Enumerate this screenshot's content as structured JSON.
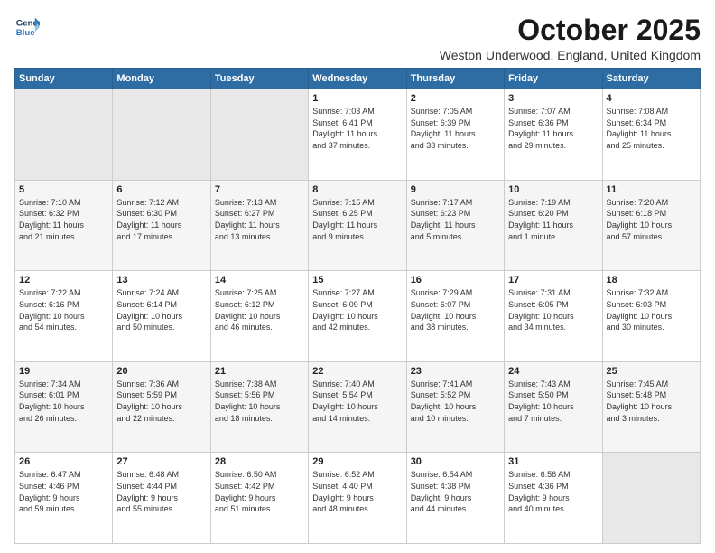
{
  "logo": {
    "line1": "General",
    "line2": "Blue"
  },
  "title": "October 2025",
  "location": "Weston Underwood, England, United Kingdom",
  "days_of_week": [
    "Sunday",
    "Monday",
    "Tuesday",
    "Wednesday",
    "Thursday",
    "Friday",
    "Saturday"
  ],
  "weeks": [
    [
      {
        "day": "",
        "info": ""
      },
      {
        "day": "",
        "info": ""
      },
      {
        "day": "",
        "info": ""
      },
      {
        "day": "1",
        "info": "Sunrise: 7:03 AM\nSunset: 6:41 PM\nDaylight: 11 hours\nand 37 minutes."
      },
      {
        "day": "2",
        "info": "Sunrise: 7:05 AM\nSunset: 6:39 PM\nDaylight: 11 hours\nand 33 minutes."
      },
      {
        "day": "3",
        "info": "Sunrise: 7:07 AM\nSunset: 6:36 PM\nDaylight: 11 hours\nand 29 minutes."
      },
      {
        "day": "4",
        "info": "Sunrise: 7:08 AM\nSunset: 6:34 PM\nDaylight: 11 hours\nand 25 minutes."
      }
    ],
    [
      {
        "day": "5",
        "info": "Sunrise: 7:10 AM\nSunset: 6:32 PM\nDaylight: 11 hours\nand 21 minutes."
      },
      {
        "day": "6",
        "info": "Sunrise: 7:12 AM\nSunset: 6:30 PM\nDaylight: 11 hours\nand 17 minutes."
      },
      {
        "day": "7",
        "info": "Sunrise: 7:13 AM\nSunset: 6:27 PM\nDaylight: 11 hours\nand 13 minutes."
      },
      {
        "day": "8",
        "info": "Sunrise: 7:15 AM\nSunset: 6:25 PM\nDaylight: 11 hours\nand 9 minutes."
      },
      {
        "day": "9",
        "info": "Sunrise: 7:17 AM\nSunset: 6:23 PM\nDaylight: 11 hours\nand 5 minutes."
      },
      {
        "day": "10",
        "info": "Sunrise: 7:19 AM\nSunset: 6:20 PM\nDaylight: 11 hours\nand 1 minute."
      },
      {
        "day": "11",
        "info": "Sunrise: 7:20 AM\nSunset: 6:18 PM\nDaylight: 10 hours\nand 57 minutes."
      }
    ],
    [
      {
        "day": "12",
        "info": "Sunrise: 7:22 AM\nSunset: 6:16 PM\nDaylight: 10 hours\nand 54 minutes."
      },
      {
        "day": "13",
        "info": "Sunrise: 7:24 AM\nSunset: 6:14 PM\nDaylight: 10 hours\nand 50 minutes."
      },
      {
        "day": "14",
        "info": "Sunrise: 7:25 AM\nSunset: 6:12 PM\nDaylight: 10 hours\nand 46 minutes."
      },
      {
        "day": "15",
        "info": "Sunrise: 7:27 AM\nSunset: 6:09 PM\nDaylight: 10 hours\nand 42 minutes."
      },
      {
        "day": "16",
        "info": "Sunrise: 7:29 AM\nSunset: 6:07 PM\nDaylight: 10 hours\nand 38 minutes."
      },
      {
        "day": "17",
        "info": "Sunrise: 7:31 AM\nSunset: 6:05 PM\nDaylight: 10 hours\nand 34 minutes."
      },
      {
        "day": "18",
        "info": "Sunrise: 7:32 AM\nSunset: 6:03 PM\nDaylight: 10 hours\nand 30 minutes."
      }
    ],
    [
      {
        "day": "19",
        "info": "Sunrise: 7:34 AM\nSunset: 6:01 PM\nDaylight: 10 hours\nand 26 minutes."
      },
      {
        "day": "20",
        "info": "Sunrise: 7:36 AM\nSunset: 5:59 PM\nDaylight: 10 hours\nand 22 minutes."
      },
      {
        "day": "21",
        "info": "Sunrise: 7:38 AM\nSunset: 5:56 PM\nDaylight: 10 hours\nand 18 minutes."
      },
      {
        "day": "22",
        "info": "Sunrise: 7:40 AM\nSunset: 5:54 PM\nDaylight: 10 hours\nand 14 minutes."
      },
      {
        "day": "23",
        "info": "Sunrise: 7:41 AM\nSunset: 5:52 PM\nDaylight: 10 hours\nand 10 minutes."
      },
      {
        "day": "24",
        "info": "Sunrise: 7:43 AM\nSunset: 5:50 PM\nDaylight: 10 hours\nand 7 minutes."
      },
      {
        "day": "25",
        "info": "Sunrise: 7:45 AM\nSunset: 5:48 PM\nDaylight: 10 hours\nand 3 minutes."
      }
    ],
    [
      {
        "day": "26",
        "info": "Sunrise: 6:47 AM\nSunset: 4:46 PM\nDaylight: 9 hours\nand 59 minutes."
      },
      {
        "day": "27",
        "info": "Sunrise: 6:48 AM\nSunset: 4:44 PM\nDaylight: 9 hours\nand 55 minutes."
      },
      {
        "day": "28",
        "info": "Sunrise: 6:50 AM\nSunset: 4:42 PM\nDaylight: 9 hours\nand 51 minutes."
      },
      {
        "day": "29",
        "info": "Sunrise: 6:52 AM\nSunset: 4:40 PM\nDaylight: 9 hours\nand 48 minutes."
      },
      {
        "day": "30",
        "info": "Sunrise: 6:54 AM\nSunset: 4:38 PM\nDaylight: 9 hours\nand 44 minutes."
      },
      {
        "day": "31",
        "info": "Sunrise: 6:56 AM\nSunset: 4:36 PM\nDaylight: 9 hours\nand 40 minutes."
      },
      {
        "day": "",
        "info": ""
      }
    ]
  ]
}
